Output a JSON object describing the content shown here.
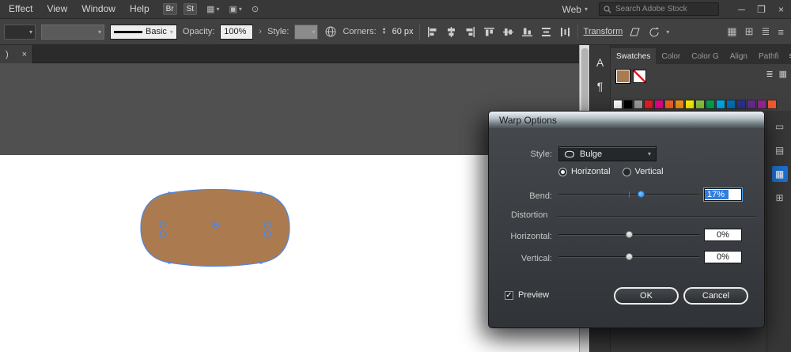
{
  "menubar": {
    "items": [
      "Effect",
      "View",
      "Window",
      "Help"
    ],
    "bridge_badge": "Br",
    "stock_badge": "St",
    "workspace_label": "Web",
    "search_placeholder": "Search Adobe Stock"
  },
  "controlbar": {
    "stroke_style_name": "Basic",
    "opacity_label": "Opacity:",
    "opacity_value": "100%",
    "style_label": "Style:",
    "corners_label": "Corners:",
    "corners_value": "60 px",
    "transform_label": "Transform"
  },
  "document": {
    "tab_label": ")",
    "close_glyph": "×"
  },
  "tools": {
    "type_tool": "A",
    "paragraph_tool": "¶"
  },
  "panels": {
    "tabs": [
      "Swatches",
      "Color",
      "Color G",
      "Align",
      "Pathfi"
    ],
    "selected_swatch_color": "#a87b50",
    "palette": [
      "#ffffff",
      "#000000",
      "#9e9e9e",
      "#ed1c24",
      "#ec008c",
      "#f26522",
      "#f7941d",
      "#fff200",
      "#8dc63f",
      "#00a651",
      "#00aeef",
      "#0072bc",
      "#2e3192",
      "#662d91",
      "#92278f",
      "#f0592e"
    ]
  },
  "artboard": {
    "shape_fill": "#ab7b4f",
    "selection_color": "#4e86e8"
  },
  "dialog": {
    "title": "Warp Options",
    "style_label": "Style:",
    "style_value": "Bulge",
    "horizontal_radio": "Horizontal",
    "vertical_radio": "Vertical",
    "bend_label": "Bend:",
    "bend_value": "17%",
    "distortion_label": "Distortion",
    "horizontal_label": "Horizontal:",
    "horizontal_value": "0%",
    "vertical_label": "Vertical:",
    "vertical_value": "0%",
    "preview_label": "Preview",
    "ok_label": "OK",
    "cancel_label": "Cancel"
  }
}
